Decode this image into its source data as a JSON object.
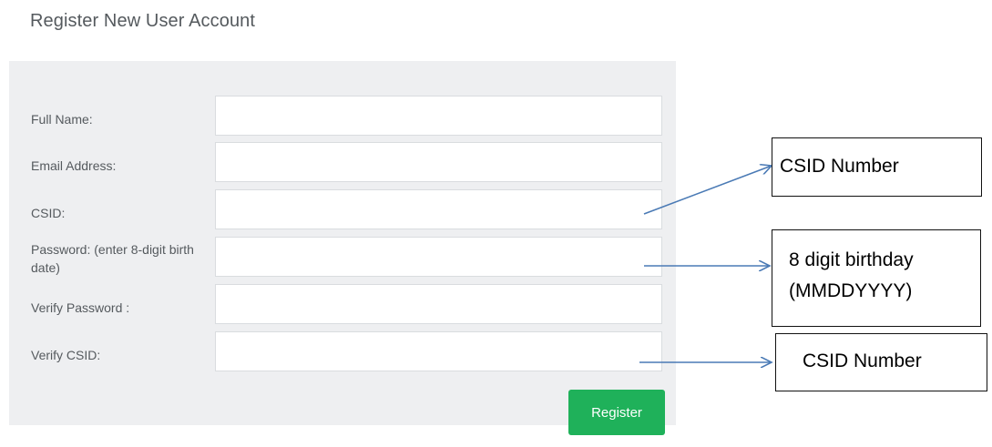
{
  "page": {
    "title": "Register New User Account"
  },
  "form": {
    "fields": [
      {
        "label": "Full Name:",
        "value": ""
      },
      {
        "label": "Email Address:",
        "value": ""
      },
      {
        "label": "CSID:",
        "value": ""
      },
      {
        "label": "Password: (enter 8-digit birth date)",
        "value": ""
      },
      {
        "label": "Verify Password :",
        "value": ""
      },
      {
        "label": "Verify CSID:",
        "value": ""
      }
    ],
    "submit_label": "Register"
  },
  "annotations": {
    "csid_note": "CSID Number",
    "birthday_note_line1": "8 digit birthday",
    "birthday_note_line2": "(MMDDYYYY)",
    "verify_csid_note": "CSID Number"
  },
  "colors": {
    "panel_background": "#eeeff1",
    "button_background": "#1fb15a",
    "arrow": "#4a7ab5"
  }
}
